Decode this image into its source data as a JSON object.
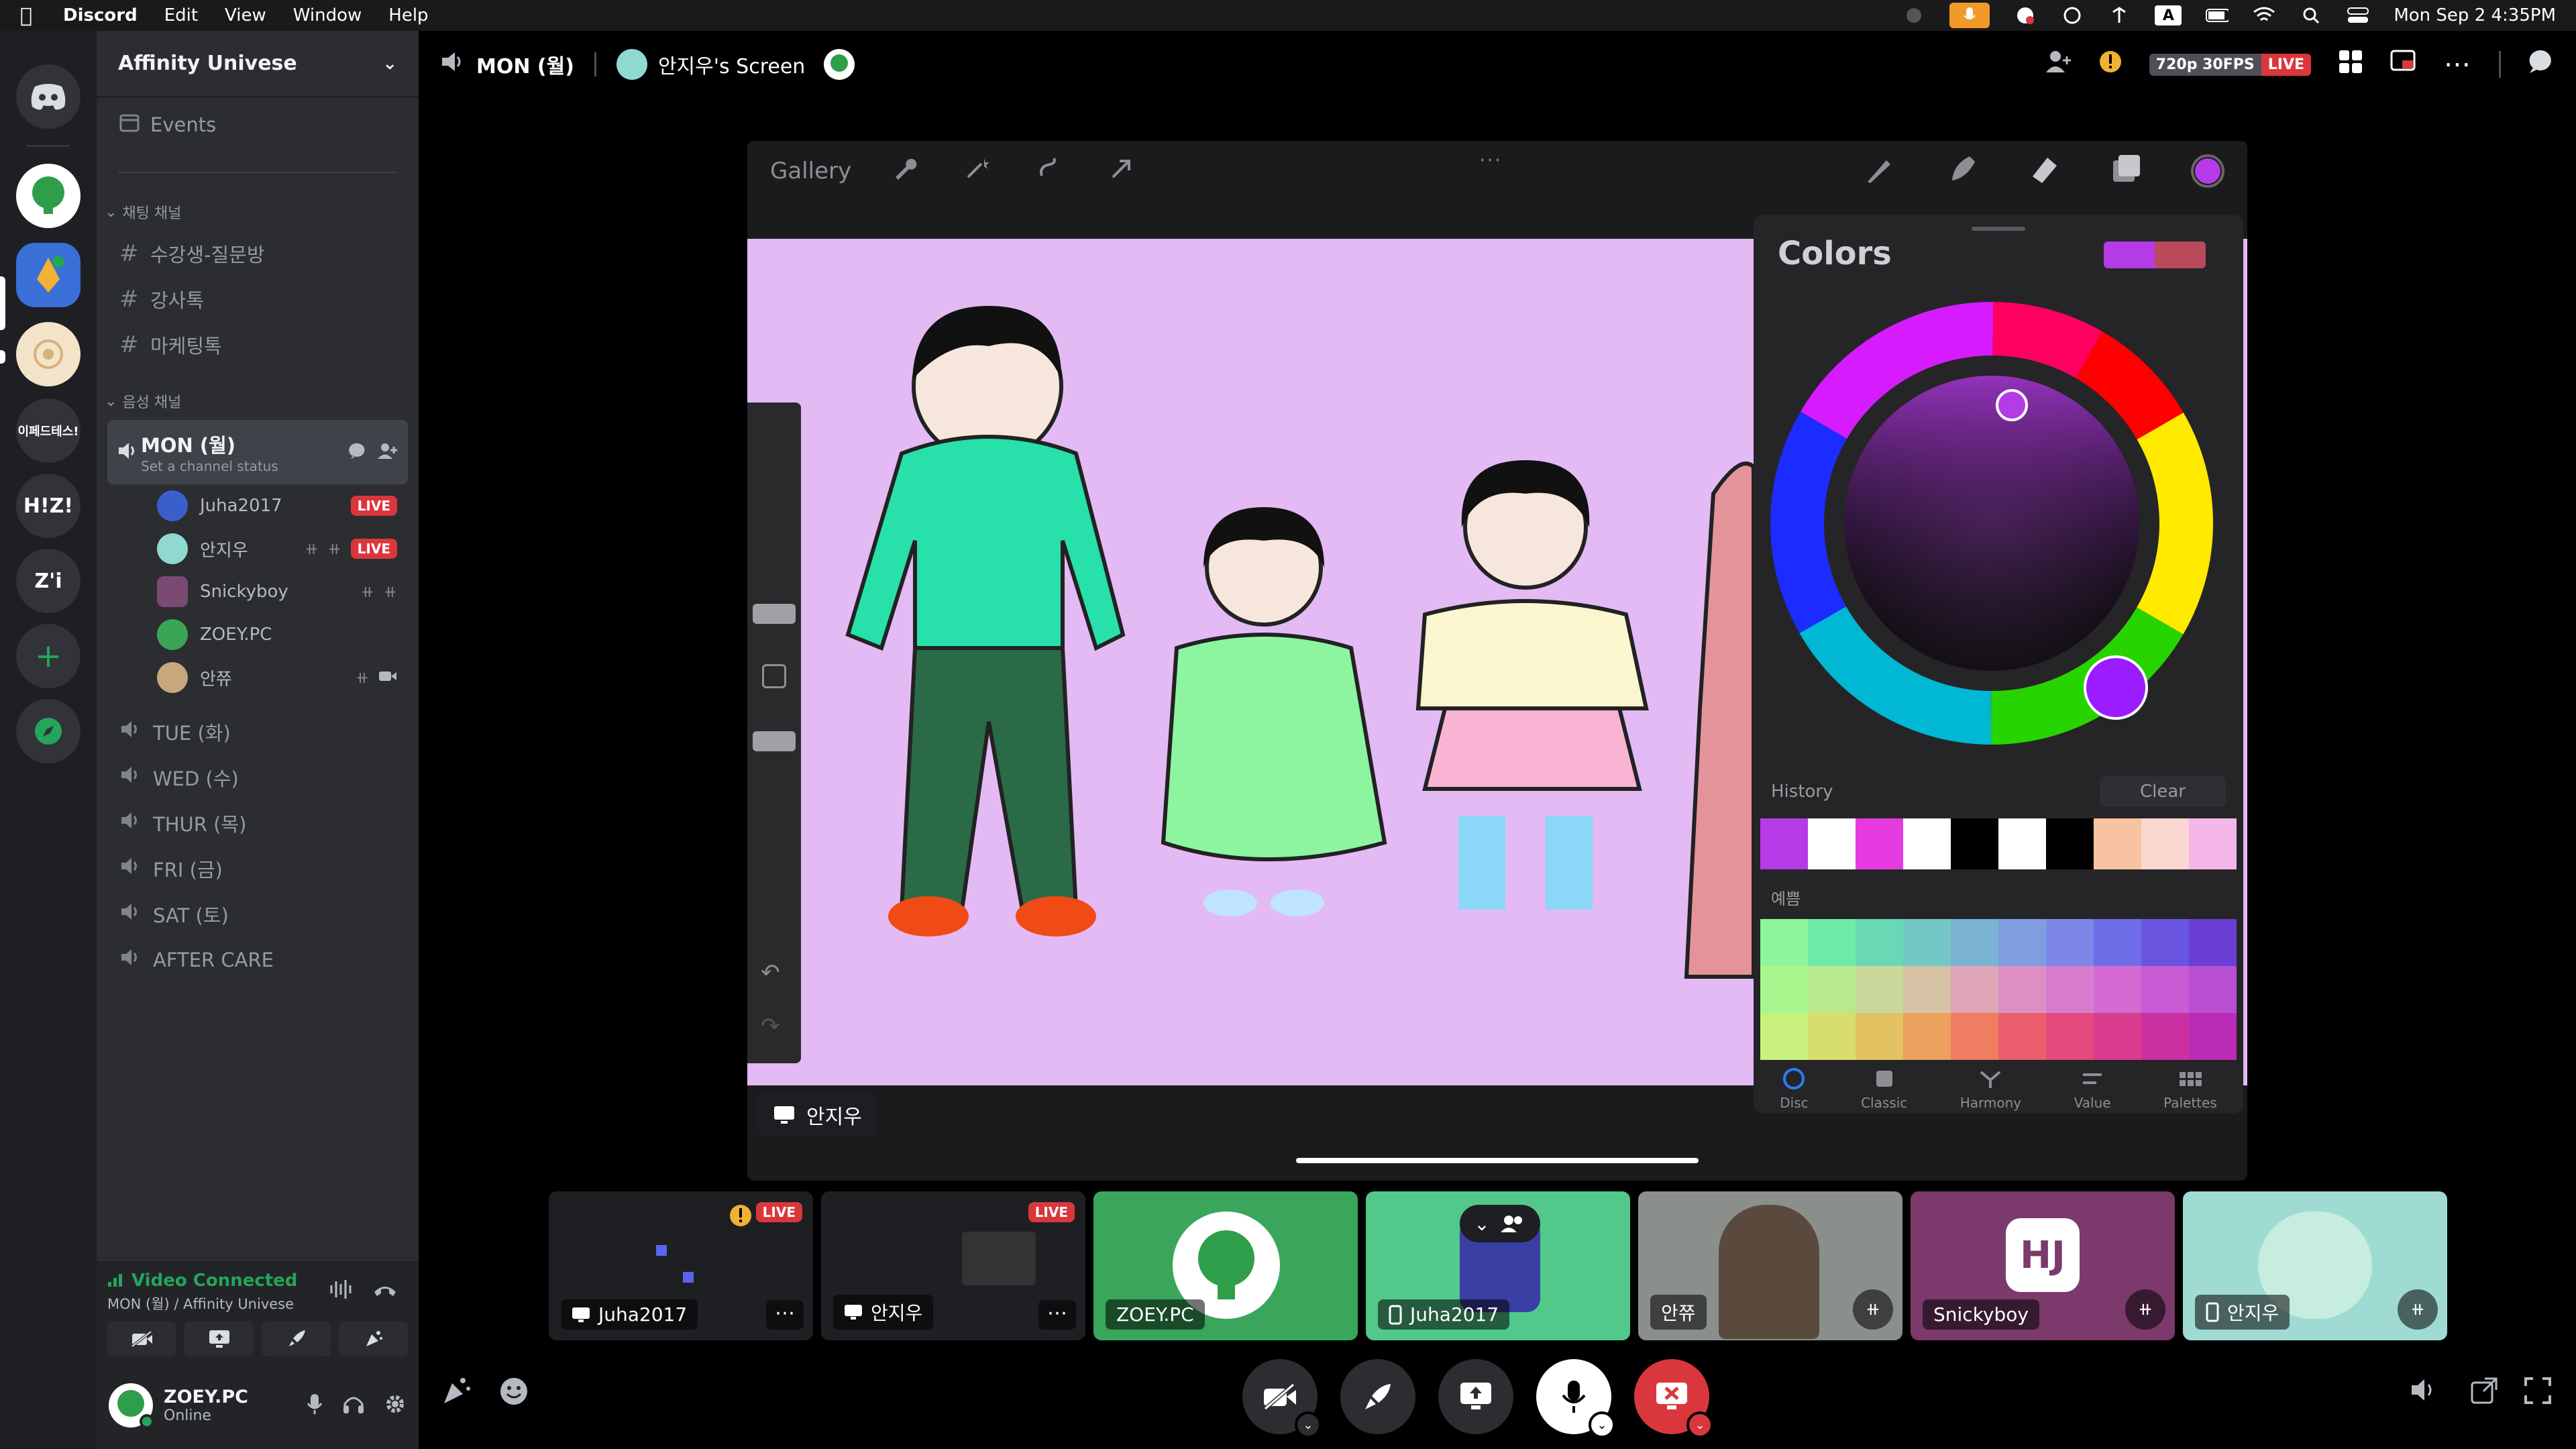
{
  "menubar": {
    "app": "Discord",
    "items": [
      "Edit",
      "View",
      "Window",
      "Help"
    ],
    "datetime": "Mon Sep 2  4:35PM",
    "input_source": "A"
  },
  "rail": {
    "servers": [
      {
        "name": "Discord Home",
        "label": ""
      },
      {
        "name": "Affinity Univese",
        "label": ""
      },
      {
        "name": "Pen server",
        "label": ""
      },
      {
        "name": "Circle server",
        "label": ""
      },
      {
        "name": "이페드테스",
        "label": "이페드테스!"
      },
      {
        "name": "H!Z!",
        "label": "H!Z!"
      },
      {
        "name": "Z'i",
        "label": "Z'i"
      }
    ]
  },
  "sidebar": {
    "server_name": "Affinity Univese",
    "events": "Events",
    "text_category": "채팅 채널",
    "text_channels": [
      "수강생-질문방",
      "강사톡",
      "마케팅톡"
    ],
    "voice_category": "음성 채널",
    "active_voice": {
      "name": "MON (월)",
      "status": "Set a channel status",
      "users": [
        {
          "name": "Juha2017",
          "live": "LIVE",
          "avatar_color": "#3a5fcd"
        },
        {
          "name": "안지우",
          "live": "LIVE",
          "avatar_color": "#8fd9d0"
        },
        {
          "name": "Snickyboy",
          "live": "",
          "avatar_color": "#7a4a73"
        },
        {
          "name": "ZOEY.PC",
          "live": "",
          "avatar_color": "#3aa655"
        },
        {
          "name": "안쮸",
          "live": "",
          "avatar_color": "#c9a77c"
        }
      ]
    },
    "voice_channels": [
      "TUE (화)",
      "WED (수)",
      "THUR (목)",
      "FRI (금)",
      "SAT (토)",
      "AFTER CARE"
    ]
  },
  "voice_panel": {
    "status": "Video Connected",
    "location": "MON (월) / Affinity Univese"
  },
  "user_panel": {
    "name": "ZOEY.PC",
    "status": "Online"
  },
  "stage": {
    "channel": "MON (월)",
    "screen_title": "안지우's Screen",
    "quality": "720p 30FPS",
    "live": "LIVE",
    "screen_owner": "안지우"
  },
  "procreate": {
    "gallery": "Gallery",
    "colors_title": "Colors",
    "history": "History",
    "clear": "Clear",
    "palette_name": "예쁨",
    "tabs": [
      "Disc",
      "Classic",
      "Harmony",
      "Value",
      "Palettes"
    ],
    "history_swatches": [
      "#b43be6",
      "#ffffff",
      "#e63be0",
      "#ffffff",
      "#000000",
      "#ffffff",
      "#000000",
      "#f8c3a0",
      "#fbd7d1",
      "#f5b7e9"
    ],
    "current_color": "#b43be6",
    "previous_color": "#b84a5c"
  },
  "tiles": [
    {
      "name": "Juha2017",
      "live": "LIVE",
      "bg": "#1e1f22"
    },
    {
      "name": "안지우",
      "live": "LIVE",
      "bg": "#1e1f22"
    },
    {
      "name": "ZOEY.PC",
      "live": "",
      "bg": "#3aa65c"
    },
    {
      "name": "Juha2017",
      "live": "",
      "bg": "#52c98a"
    },
    {
      "name": "안쮸",
      "live": "",
      "bg": "#8a8f8c"
    },
    {
      "name": "Snickyboy",
      "live": "",
      "bg": "#7b3a6b"
    },
    {
      "name": "안지우",
      "live": "",
      "bg": "#9fdbd3"
    }
  ],
  "colors": {
    "discord_bg": "#2b2d31",
    "live_red": "#da373c",
    "online_green": "#23a55a",
    "canvas_bg": "#e3baf4"
  }
}
